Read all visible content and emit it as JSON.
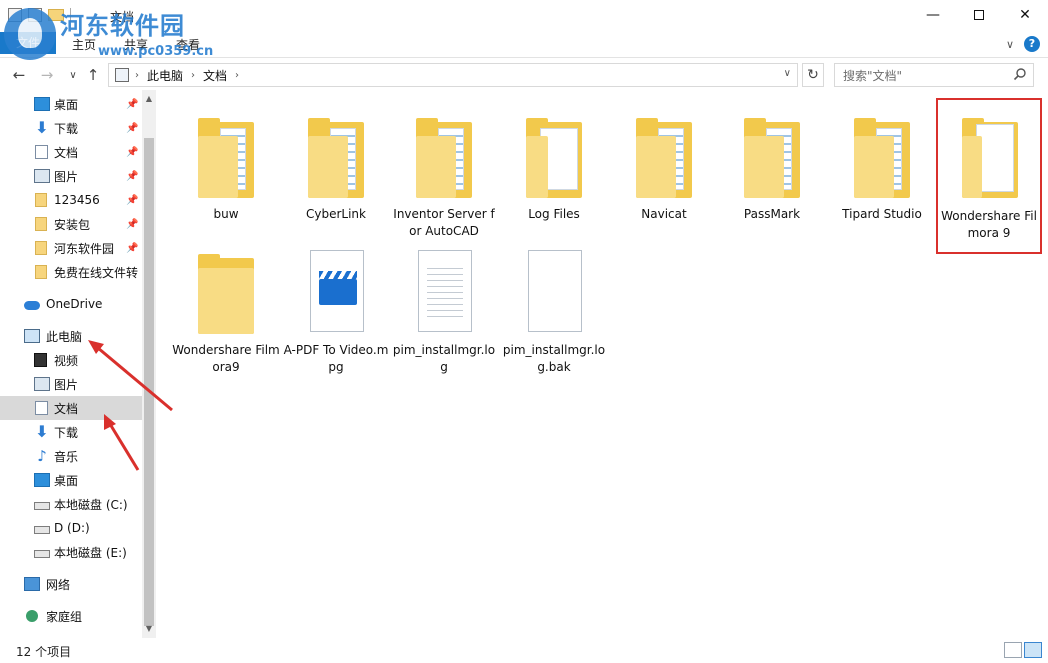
{
  "window": {
    "title": "文档",
    "controls": {
      "minimize": "—",
      "maximize": "",
      "close": "✕"
    }
  },
  "watermark": {
    "title": "河东软件园",
    "url": "www.pc0359.cn"
  },
  "ribbon": {
    "tabs": [
      "文件",
      "主页",
      "共享",
      "查看"
    ],
    "expand": "∨",
    "help": "?"
  },
  "nav": {
    "back": "←",
    "forward": "→",
    "recent": "∨",
    "up": "↑",
    "breadcrumbs": [
      "此电脑",
      "文档"
    ],
    "crumb_sep": "›",
    "dropdown": "∨",
    "refresh": "↻",
    "search_placeholder": "搜索\"文档\""
  },
  "sidebar": {
    "quick_access": [
      {
        "label": "桌面",
        "icon": "desktop-icon",
        "pinned": true
      },
      {
        "label": "下载",
        "icon": "download-icon",
        "pinned": true
      },
      {
        "label": "文档",
        "icon": "document-icon",
        "pinned": true
      },
      {
        "label": "图片",
        "icon": "pictures-icon",
        "pinned": true
      },
      {
        "label": "123456",
        "icon": "folder-icon",
        "pinned": true
      },
      {
        "label": "安装包",
        "icon": "folder-icon",
        "pinned": true
      },
      {
        "label": "河东软件园",
        "icon": "folder-icon",
        "pinned": true
      },
      {
        "label": "免费在线文件转",
        "icon": "folder-icon",
        "pinned": false
      }
    ],
    "onedrive": "OneDrive",
    "this_pc": "此电脑",
    "pc_items": [
      {
        "label": "视频",
        "icon": "video-icon"
      },
      {
        "label": "图片",
        "icon": "pictures-icon"
      },
      {
        "label": "文档",
        "icon": "document-icon",
        "selected": true
      },
      {
        "label": "下载",
        "icon": "download-icon"
      },
      {
        "label": "音乐",
        "icon": "music-icon"
      },
      {
        "label": "桌面",
        "icon": "desktop-icon"
      },
      {
        "label": "本地磁盘 (C:)",
        "icon": "drive-icon"
      },
      {
        "label": "D (D:)",
        "icon": "drive-icon"
      },
      {
        "label": "本地磁盘 (E:)",
        "icon": "drive-icon"
      }
    ],
    "network": "网络",
    "homegroup": "家庭组",
    "pin_glyph": "📌",
    "scroll_up": "▲",
    "scroll_down": "▼"
  },
  "files": [
    {
      "name": "buw",
      "type": "folder-docs"
    },
    {
      "name": "CyberLink",
      "type": "folder-docs"
    },
    {
      "name": "Inventor Server for AutoCAD",
      "type": "folder-docs"
    },
    {
      "name": "Log Files",
      "type": "folder-paper"
    },
    {
      "name": "Navicat",
      "type": "folder-docs"
    },
    {
      "name": "PassMark",
      "type": "folder-docs"
    },
    {
      "name": "Tipard Studio",
      "type": "folder-docs"
    },
    {
      "name": "Wondershare Filmora 9",
      "type": "folder-paper",
      "highlighted": true
    },
    {
      "name": "Wondershare Filmora9",
      "type": "folder-empty"
    },
    {
      "name": "A-PDF To Video.mpg",
      "type": "video-file"
    },
    {
      "name": "pim_installmgr.log",
      "type": "text-file"
    },
    {
      "name": "pim_installmgr.log.bak",
      "type": "blank-file"
    }
  ],
  "status": {
    "item_count": "12 个项目"
  },
  "colors": {
    "accent": "#1979ca",
    "highlight_border": "#d9302c",
    "arrow": "#d9302c"
  }
}
